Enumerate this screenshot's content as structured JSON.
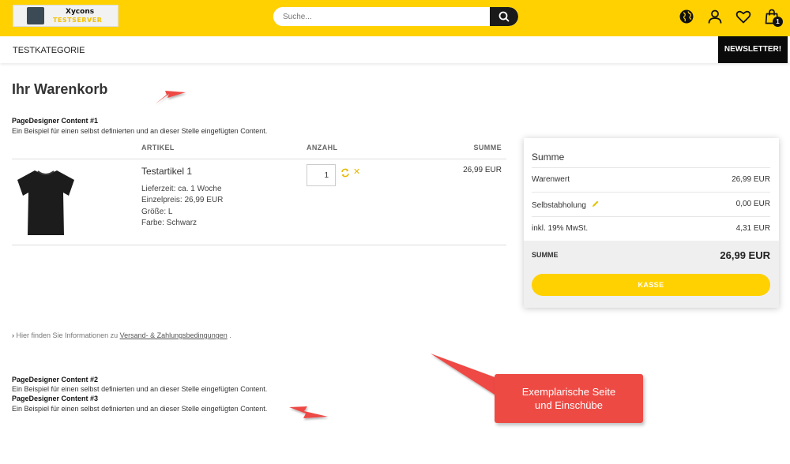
{
  "header": {
    "logo_text_1": "Xycons",
    "logo_text_2": "TESTSERVER",
    "search_placeholder": "Suche...",
    "cart_count": "1",
    "icons": [
      "globe-icon",
      "user-icon",
      "heart-icon",
      "cart-icon",
      "search-icon"
    ]
  },
  "nav": {
    "category": "TESTKATEGORIE",
    "newsletter": "NEWSLETTER!"
  },
  "page": {
    "title": "Ihr Warenkorb"
  },
  "pagedesigner": [
    {
      "title": "PageDesigner Content #1",
      "text": "Ein Beispiel für einen selbst definierten und an dieser Stelle eingefügten Content."
    },
    {
      "title": "PageDesigner Content #2",
      "text": "Ein Beispiel für einen selbst definierten und an dieser Stelle eingefügten Content."
    },
    {
      "title": "PageDesigner Content #3",
      "text": "Ein Beispiel für einen selbst definierten und an dieser Stelle eingefügten Content."
    }
  ],
  "cart_table": {
    "headers": [
      "ARTIKEL",
      "ANZAHL",
      "SUMME"
    ],
    "item": {
      "name": "Testartikel 1",
      "delivery": "Lieferzeit: ca. 1 Woche",
      "unit_price": "Einzelpreis: 26,99 EUR",
      "size": "Größe: L",
      "color": "Farbe: Schwarz",
      "quantity": "1",
      "sum": "26,99 EUR"
    }
  },
  "summary": {
    "title": "Summe",
    "rows": [
      {
        "label": "Warenwert",
        "value": "26,99 EUR"
      },
      {
        "label": "Selbstabholung",
        "value": "0,00 EUR"
      },
      {
        "label": "inkl. 19% MwSt.",
        "value": "4,31 EUR"
      }
    ],
    "total_label": "SUMME",
    "total_value": "26,99 EUR",
    "checkout_button": "KASSE"
  },
  "info": {
    "prefix": "Hier finden Sie Informationen zu",
    "link": "Versand- & Zahlungsbedingungen",
    "suffix": "."
  },
  "callout": {
    "line1": "Exemplarische Seite",
    "line2": "und Einschübe"
  },
  "colors": {
    "brand_yellow": "#ffd100",
    "dark": "#0a0a0a",
    "callout_red": "#ee4a44"
  }
}
